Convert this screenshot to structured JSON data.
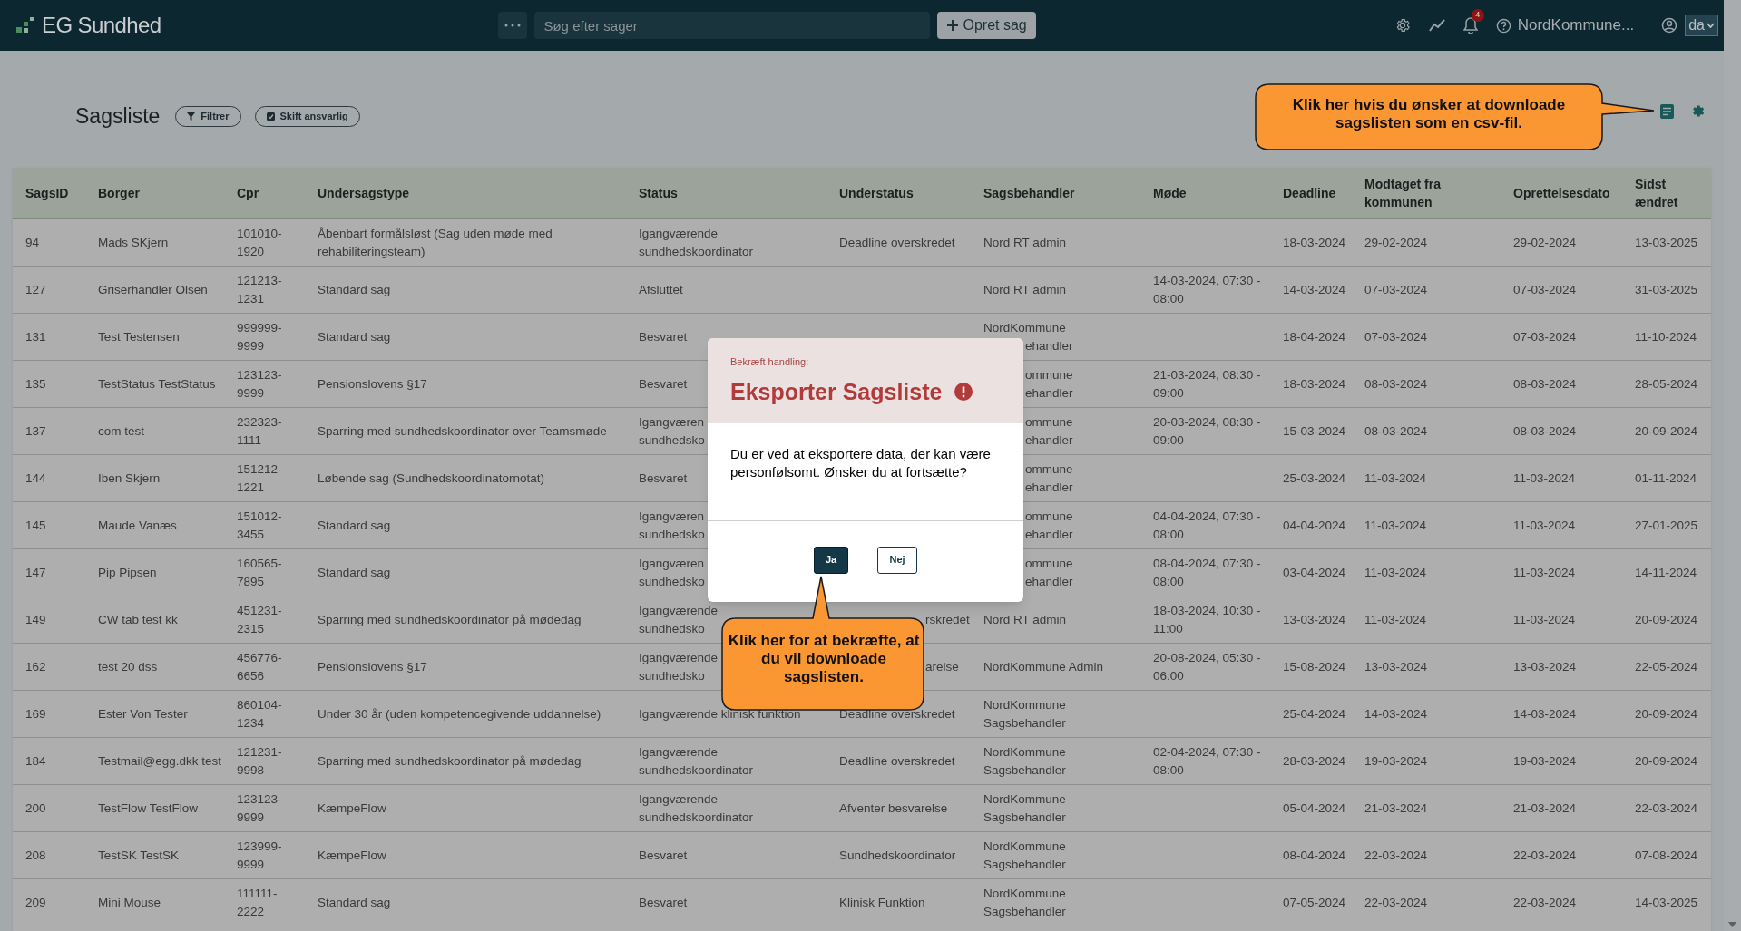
{
  "app": {
    "logo": "EG Sundhed",
    "search": {
      "placeholder": "Søg efter sager"
    },
    "create_button": "Opret sag",
    "notification_count": "4",
    "user": "NordKommune...",
    "language": "da"
  },
  "page": {
    "title": "Sagsliste",
    "buttons": [
      {
        "label": "Filtrer",
        "kind": "filter"
      },
      {
        "label": "Skift ansvarlig",
        "kind": "assign"
      }
    ]
  },
  "callouts": [
    {
      "text": "Klik her hvis du ønsker at downloade sagslisten som en csv-fil.",
      "kind": "right"
    },
    {
      "text": "Klik her for at bekræfte, at du vil downloade sagslisten.",
      "kind": "up"
    }
  ],
  "table": {
    "columns": [
      "SagsID",
      "Borger",
      "Cpr",
      "Undersagstype",
      "Status",
      "Understatus",
      "Sagsbehandler",
      "Møde",
      "Deadline",
      "Modtaget fra kommunen",
      "Oprettelsesdato",
      "Sidst ændret"
    ],
    "rows": [
      [
        "94",
        "Mads SKjern",
        "101010-1920",
        "Åbenbart formålsløst (Sag uden møde med rehabiliteringsteam)",
        "Igangværende sundhedskoordinator",
        "Deadline overskredet",
        "Nord RT admin",
        null,
        "18-03-2024",
        "29-02-2024",
        "29-02-2024",
        "13-03-2025"
      ],
      [
        "127",
        "Griserhandler Olsen",
        "121213-1231",
        "Standard sag",
        "Afsluttet",
        null,
        "Nord RT admin",
        "14-03-2024, 07:30 - 08:00",
        "14-03-2024",
        "07-03-2024",
        "07-03-2024",
        "31-03-2025"
      ],
      [
        "131",
        "Test Testensen",
        "999999-9999",
        "Standard sag",
        "Besvaret",
        null,
        {
          "lines": [
            {
              "text": "NordKommune"
            },
            {
              "text": "ehandler",
              "cut_start": true
            }
          ]
        },
        null,
        "18-04-2024",
        "07-03-2024",
        "07-03-2024",
        "11-10-2024"
      ],
      [
        "135",
        "TestStatus TestStatus",
        "123123-9999",
        "Pensionslovens §17",
        "Besvaret",
        null,
        {
          "lines": [
            {
              "text": "ommune",
              "cut_start": true
            },
            {
              "text": "ehandler",
              "cut_start": true
            }
          ]
        },
        "21-03-2024, 08:30 - 09:00",
        "18-03-2024",
        "08-03-2024",
        "08-03-2024",
        "28-05-2024"
      ],
      [
        "137",
        "com test",
        "232323-1111",
        "Sparring med sundhedskoordinator over Teamsmøde",
        {
          "lines": [
            {
              "text": "Igangværen"
            },
            {
              "text": "sundhedsko"
            }
          ]
        },
        null,
        {
          "lines": [
            {
              "text": "ommune",
              "cut_start": true
            },
            {
              "text": "ehandler",
              "cut_start": true
            }
          ]
        },
        "20-03-2024, 08:30 - 09:00",
        "15-03-2024",
        "08-03-2024",
        "08-03-2024",
        "20-09-2024"
      ],
      [
        "144",
        "Iben Skjern",
        "151212-1221",
        "Løbende sag (Sundhedskoordinatornotat)",
        "Besvaret",
        null,
        {
          "lines": [
            {
              "text": "ommune",
              "cut_start": true
            },
            {
              "text": "ehandler",
              "cut_start": true
            }
          ]
        },
        null,
        "25-03-2024",
        "11-03-2024",
        "11-03-2024",
        "01-11-2024"
      ],
      [
        "145",
        "Maude Vanæs",
        "151012-3455",
        "Standard sag",
        {
          "lines": [
            {
              "text": "Igangværen"
            },
            {
              "text": "sundhedsko"
            }
          ]
        },
        null,
        {
          "lines": [
            {
              "text": "ommune",
              "cut_start": true
            },
            {
              "text": "ehandler",
              "cut_start": true
            }
          ]
        },
        "04-04-2024, 07:30 - 08:00",
        "04-04-2024",
        "11-03-2024",
        "11-03-2024",
        "27-01-2025"
      ],
      [
        "147",
        "Pip Pipsen",
        "160565-7895",
        "Standard sag",
        {
          "lines": [
            {
              "text": "Igangværen"
            },
            {
              "text": "sundhedsko"
            }
          ]
        },
        null,
        {
          "lines": [
            {
              "text": "ommune",
              "cut_start": true
            },
            {
              "text": "ehandler",
              "cut_start": true
            }
          ]
        },
        "08-04-2024, 07:30 - 08:00",
        "03-04-2024",
        "11-03-2024",
        "11-03-2024",
        "14-11-2024"
      ],
      [
        "149",
        "CW tab test kk",
        "451231-2315",
        "Sparring med sundhedskoordinator på mødedag",
        {
          "lines": [
            {
              "text": "Igangværende"
            },
            {
              "text": "sundhedsko"
            }
          ]
        },
        {
          "lines": [
            {
              "text": "rskredet",
              "cut_start": true
            }
          ]
        },
        "Nord RT admin",
        "18-03-2024, 10:30 - 11:00",
        "13-03-2024",
        "11-03-2024",
        "11-03-2024",
        "20-09-2024"
      ],
      [
        "162",
        "test 20 dss",
        "456776-6656",
        "Pensionslovens §17",
        {
          "lines": [
            {
              "text": "Igangværende"
            },
            {
              "text": "sundhedsko"
            }
          ]
        },
        {
          "lines": [
            {
              "text": "arelse",
              "cut_start": true
            }
          ]
        },
        "NordKommune Admin",
        "20-08-2024, 05:30 - 06:00",
        "15-08-2024",
        "13-03-2024",
        "13-03-2024",
        "22-05-2024"
      ],
      [
        "169",
        "Ester Von Tester",
        "860104-1234",
        "Under 30 år (uden kompetencegivende uddannelse)",
        "Igangværende klinisk funktion",
        "Deadline overskredet",
        "NordKommune Sagsbehandler",
        null,
        "25-04-2024",
        "14-03-2024",
        "14-03-2024",
        "20-09-2024"
      ],
      [
        "184",
        "Testmail@egg.dkk test",
        "121231-9998",
        "Sparring med sundhedskoordinator på mødedag",
        "Igangværende sundhedskoordinator",
        "Deadline overskredet",
        "NordKommune Sagsbehandler",
        "02-04-2024, 07:30 - 08:00",
        "28-03-2024",
        "19-03-2024",
        "19-03-2024",
        "20-09-2024"
      ],
      [
        "200",
        "TestFlow TestFlow",
        "123123-9999",
        "KæmpeFlow",
        "Igangværende sundhedskoordinator",
        "Afventer besvarelse",
        "NordKommune Sagsbehandler",
        null,
        "05-04-2024",
        "21-03-2024",
        "21-03-2024",
        "22-03-2024"
      ],
      [
        "208",
        "TestSK TestSK",
        "123999-9999",
        "KæmpeFlow",
        "Besvaret",
        "Sundhedskoordinator",
        "NordKommune Sagsbehandler",
        null,
        "08-04-2024",
        "22-03-2024",
        "22-03-2024",
        "07-08-2024"
      ],
      [
        "209",
        "Mini Mouse",
        "111111-2222",
        "Standard sag",
        "Besvaret",
        "Klinisk Funktion",
        "NordKommune Sagsbehandler",
        null,
        "07-05-2024",
        "22-03-2024",
        "22-03-2024",
        "14-03-2025"
      ]
    ]
  },
  "dialog": {
    "kicker": "Bekræft handling:",
    "title": "Eksporter Sagsliste",
    "message": "Du er ved at eksportere data, der kan være personfølsomt. Ønsker du at fortsætte?",
    "buttons": [
      {
        "label": "Ja",
        "kind": "primary"
      },
      {
        "label": "Nej",
        "kind": "secondary"
      }
    ]
  }
}
